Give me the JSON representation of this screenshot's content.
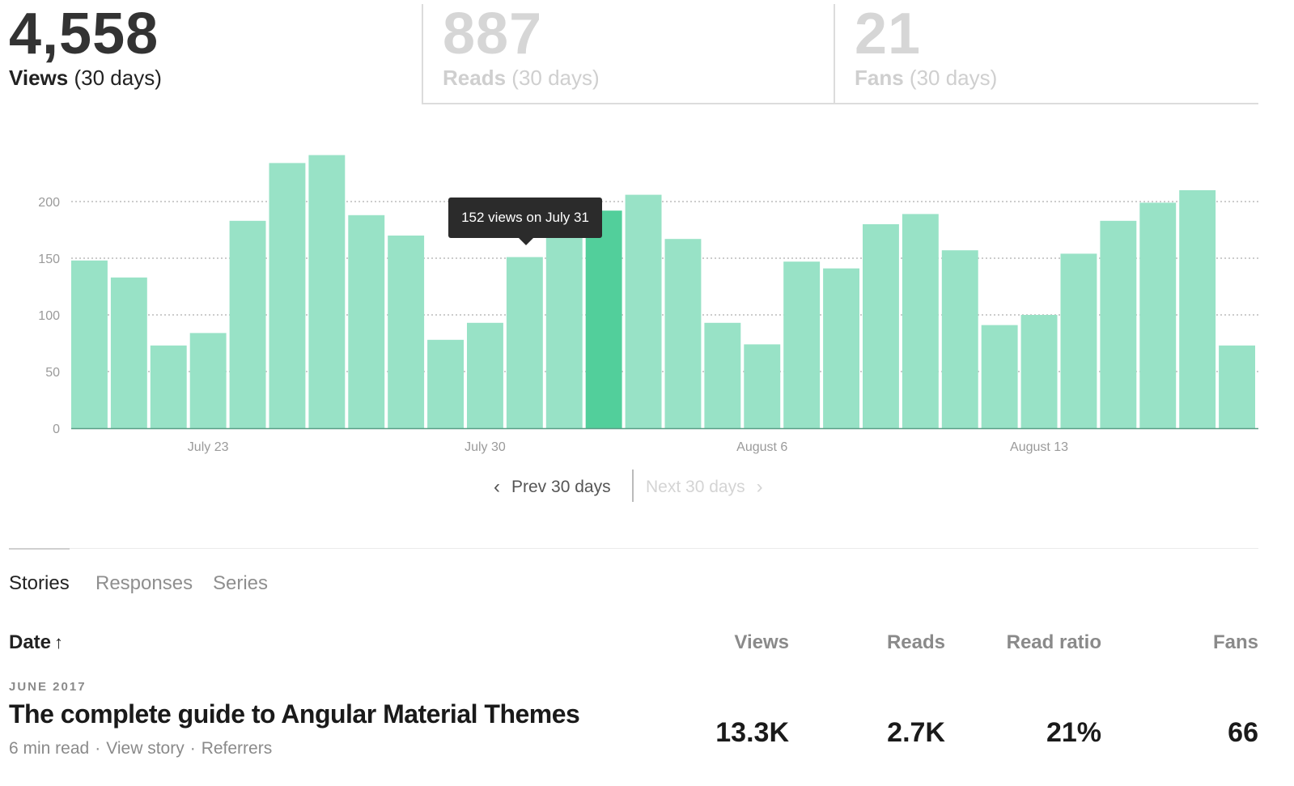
{
  "stats": {
    "views": {
      "number": "4,558",
      "label": "Views",
      "period": "(30 days)"
    },
    "reads": {
      "number": "887",
      "label": "Reads",
      "period": "(30 days)"
    },
    "fans": {
      "number": "21",
      "label": "Fans",
      "period": "(30 days)"
    }
  },
  "chart_data": {
    "type": "bar",
    "series_name": "views",
    "categories": [
      "July 20",
      "July 21",
      "July 22",
      "July 23",
      "July 24",
      "July 25",
      "July 26",
      "July 27",
      "July 28",
      "July 29",
      "July 30",
      "July 31",
      "August 1",
      "August 2",
      "August 3",
      "August 4",
      "August 5",
      "August 6",
      "August 7",
      "August 8",
      "August 9",
      "August 10",
      "August 11",
      "August 12",
      "August 13",
      "August 14",
      "August 15",
      "August 16",
      "August 17",
      "August 18"
    ],
    "values": [
      148,
      133,
      73,
      84,
      183,
      234,
      241,
      188,
      170,
      78,
      93,
      151,
      178,
      192,
      206,
      167,
      93,
      74,
      147,
      141,
      180,
      189,
      157,
      91,
      100,
      154,
      183,
      199,
      210,
      73
    ],
    "highlighted_index": 13,
    "yticks": [
      0,
      50,
      100,
      150,
      200
    ],
    "ylim": [
      0,
      245
    ],
    "xtick_labels": [
      {
        "index": 3,
        "label": "July 23"
      },
      {
        "index": 10,
        "label": "July 30"
      },
      {
        "index": 17,
        "label": "August 6"
      },
      {
        "index": 24,
        "label": "August 13"
      }
    ],
    "grid": "dotted horizontal",
    "bar_color": "#98e2c6",
    "highlight_color": "#52cf9b"
  },
  "tooltip": {
    "text": "152 views on July 31"
  },
  "pager": {
    "prev": "Prev 30 days",
    "next": "Next 30 days"
  },
  "tabs": [
    "Stories",
    "Responses",
    "Series"
  ],
  "table": {
    "headers": {
      "date": "Date",
      "date_sort": "↑",
      "views": "Views",
      "reads": "Reads",
      "ratio": "Read ratio",
      "fans": "Fans"
    },
    "rows": [
      {
        "month": "JUNE 2017",
        "title": "The complete guide to Angular Material Themes",
        "read_time": "6 min read",
        "view_story": "View story",
        "referrers": "Referrers",
        "views": "13.3K",
        "reads": "2.7K",
        "ratio": "21%",
        "fans": "66"
      }
    ]
  }
}
